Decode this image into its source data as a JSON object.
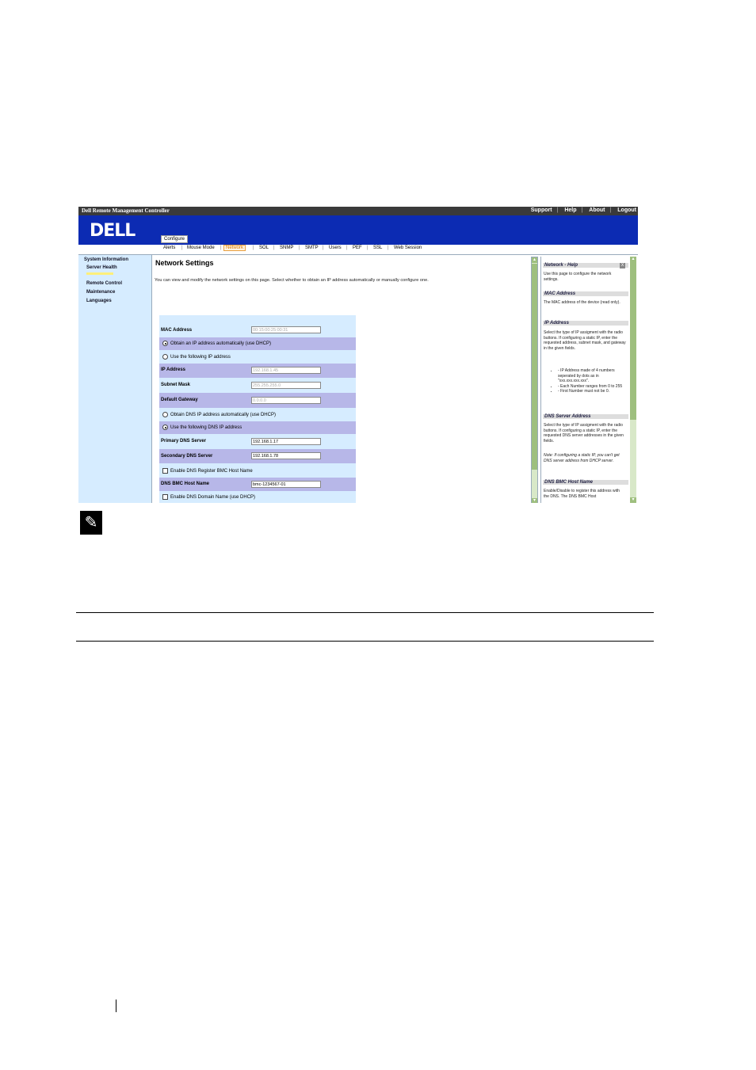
{
  "topbar": {
    "title": "Dell Remote Management Controller",
    "links": [
      "Support",
      "Help",
      "About",
      "Logout"
    ]
  },
  "banner": {
    "logo": "DELL",
    "active_tab": "Configure"
  },
  "subnav": {
    "items": [
      "Alerts",
      "Mouse Mode",
      "Network",
      "SOL",
      "SNMP",
      "SMTP",
      "Users",
      "PEF",
      "SSL",
      "Web Session"
    ],
    "active": "Network"
  },
  "leftnav": {
    "items": [
      "System Information",
      "Server Health",
      "Remote Control",
      "Maintenance",
      "Languages"
    ]
  },
  "main": {
    "title": "Network Settings",
    "description": "You can view and modify the network settings on this page. Select whether to obtain an IP address automatically or manually configure one.",
    "mac_label": "MAC Address",
    "mac_value": "00:15:00:25:00:31",
    "opt_dhcp": "Obtain an IP address automatically (use DHCP)",
    "opt_static": "Use the following IP address",
    "ip_label": "IP Address",
    "ip_value": "192.168.1.45",
    "mask_label": "Subnet Mask",
    "mask_value": "255.255.255.0",
    "gw_label": "Default Gateway",
    "gw_value": "0.0.0.0",
    "opt_dns_dhcp": "Obtain DNS IP address automatically (use DHCP)",
    "opt_dns_static": "Use the following DNS IP address",
    "dns1_label": "Primary DNS Server",
    "dns1_value": "192.168.1.17",
    "dns2_label": "Secondary DNS Server",
    "dns2_value": "192.168.1.78",
    "chk_register": "Enable DNS Register BMC Host Name",
    "host_label": "DNS BMC Host Name",
    "host_value": "bmc-1234567-01",
    "chk_domain": "Enable DNS Domain Name (use DHCP)"
  },
  "help": {
    "title": "Network - Help",
    "close": "X",
    "intro": "Use this page to configure the network settings.",
    "mac_h": "MAC Address",
    "mac_t": "The MAC address of the device (read only).",
    "ip_h": "IP Address",
    "ip_t": "Select the type of IP assigment with the radio buttons. If configuring a static IP, enter the requested address, subnet mask, and gateway in the given fields.",
    "bullets": [
      "- IP Address made of 4 numbers seperated by dots as in \"xxx.xxx.xxx.xxx\".",
      "- Each Number ranges from 0 to 255",
      "- First Number must not be 0."
    ],
    "dns_h": "DNS Server Address",
    "dns_t": "Select the type of IP assigment with the radio buttons. If configuring a static IP, enter the requested DNS server addresses in the given fields.",
    "dns_note": "Note: If configuring a static IP, you can't get DNS server address from DHCP server.",
    "host_h": "DNS BMC Host Name",
    "host_t": "Enable/Disable to register this address with the DNS. The DNS BMC Host"
  },
  "note_icon": "pencil-icon"
}
